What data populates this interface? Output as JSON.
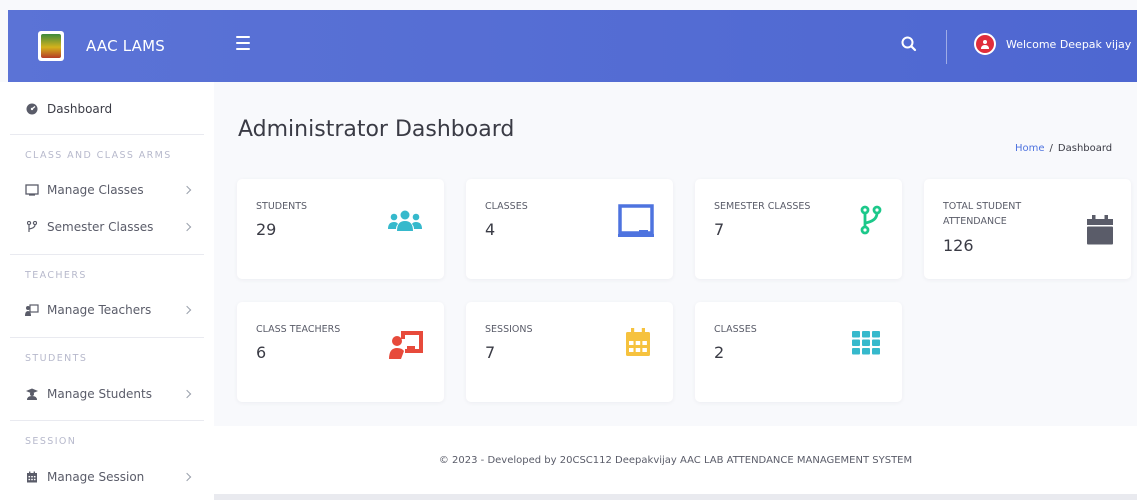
{
  "app": {
    "name": "AAC LAMS"
  },
  "topbar": {
    "welcome": "Welcome Deepak vijay"
  },
  "sidebar": {
    "dashboard": "Dashboard",
    "sections": [
      {
        "heading": "CLASS AND CLASS ARMS",
        "items": [
          "Manage Classes",
          "Semester Classes"
        ]
      },
      {
        "heading": "TEACHERS",
        "items": [
          "Manage Teachers"
        ]
      },
      {
        "heading": "STUDENTS",
        "items": [
          "Manage Students"
        ]
      },
      {
        "heading": "SESSION",
        "items": [
          "Manage Session"
        ]
      }
    ]
  },
  "page": {
    "title": "Administrator Dashboard",
    "breadcrumb": {
      "home": "Home",
      "sep": "/",
      "current": "Dashboard"
    }
  },
  "cards": [
    {
      "label": "STUDENTS",
      "value": "29",
      "icon": "users-icon",
      "color": "#36b9cc"
    },
    {
      "label": "CLASSES",
      "value": "4",
      "icon": "chalkboard-icon",
      "color": "#4e73df"
    },
    {
      "label": "SEMESTER CLASSES",
      "value": "7",
      "icon": "code-branch-icon",
      "color": "#1cc88a"
    },
    {
      "label": "TOTAL STUDENT ATTENDANCE",
      "value": "126",
      "icon": "calendar-icon",
      "color": "#5a5c69"
    },
    {
      "label": "CLASS TEACHERS",
      "value": "6",
      "icon": "chalkboard-teacher-icon",
      "color": "#e74a3b"
    },
    {
      "label": "SESSIONS",
      "value": "7",
      "icon": "calendar-alt-icon",
      "color": "#f6c23e"
    },
    {
      "label": "CLASSES",
      "value": "2",
      "icon": "th-icon",
      "color": "#36b9cc"
    }
  ],
  "footer": {
    "text": "© 2023 - Developed by 20CSC112 Deepakvijay AAC LAB ATTENDANCE MANAGEMENT SYSTEM"
  }
}
